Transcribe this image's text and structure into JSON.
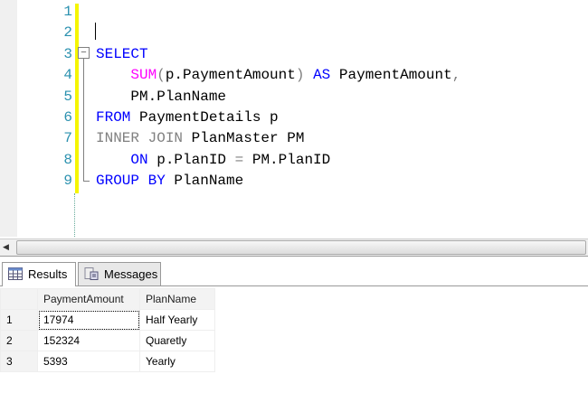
{
  "editor": {
    "line_numbers": [
      "1",
      "2",
      "3",
      "4",
      "5",
      "6",
      "7",
      "8",
      "9"
    ],
    "lines": [
      {
        "parts": []
      },
      {
        "parts": []
      },
      {
        "parts": [
          {
            "t": "SELECT",
            "c": "kw"
          }
        ]
      },
      {
        "parts": [
          {
            "t": "    "
          },
          {
            "t": "SUM",
            "c": "fn"
          },
          {
            "t": "(",
            "c": "gr"
          },
          {
            "t": "p.PaymentAmount"
          },
          {
            "t": ")",
            "c": "gr"
          },
          {
            "t": " "
          },
          {
            "t": "AS",
            "c": "kw"
          },
          {
            "t": " PaymentAmount"
          },
          {
            "t": ",",
            "c": "gr"
          }
        ]
      },
      {
        "parts": [
          {
            "t": "    PM.PlanName"
          }
        ]
      },
      {
        "parts": [
          {
            "t": "FROM",
            "c": "kw"
          },
          {
            "t": " PaymentDetails p"
          }
        ]
      },
      {
        "parts": [
          {
            "t": "INNER JOIN",
            "c": "gr"
          },
          {
            "t": " PlanMaster PM"
          }
        ]
      },
      {
        "parts": [
          {
            "t": "    "
          },
          {
            "t": "ON",
            "c": "kw"
          },
          {
            "t": " p.PlanID "
          },
          {
            "t": "=",
            "c": "gr"
          },
          {
            "t": " PM.PlanID"
          }
        ]
      },
      {
        "parts": [
          {
            "t": "GROUP BY",
            "c": "kw"
          },
          {
            "t": " PlanName"
          }
        ]
      }
    ]
  },
  "tabs": {
    "results": "Results",
    "messages": "Messages"
  },
  "grid": {
    "headers": [
      "PaymentAmount",
      "PlanName"
    ],
    "rows": [
      [
        "1",
        "17974",
        "Half Yearly"
      ],
      [
        "2",
        "152324",
        "Quaretly"
      ],
      [
        "3",
        "5393",
        "Yearly"
      ]
    ]
  }
}
